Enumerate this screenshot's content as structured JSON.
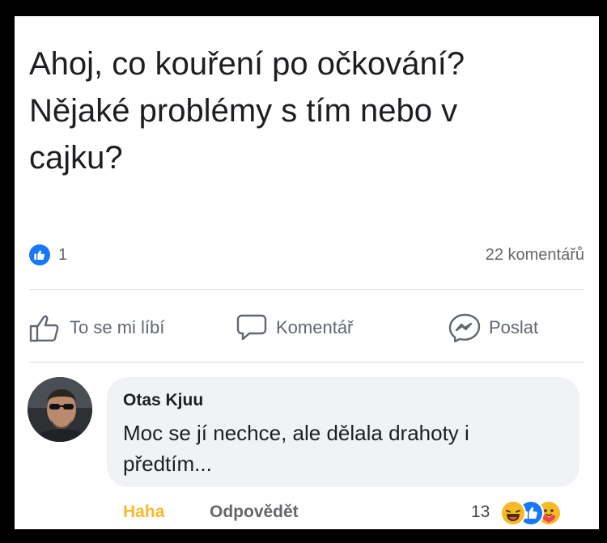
{
  "post": {
    "text_lines": [
      "Ahoj, co kouření po očkování?",
      "Nějaké problémy s tím nebo v",
      "cajku?"
    ]
  },
  "stats": {
    "like_count": "1",
    "comments": "22 komentářů",
    "colors": {
      "like_badge": "#1877f2",
      "text": "#65676b"
    }
  },
  "actions": {
    "like": {
      "label": "To se mi líbí",
      "icon": "thumbs-up-outline-icon"
    },
    "comment": {
      "label": "Komentář",
      "icon": "speech-bubble-icon"
    },
    "share": {
      "label": "Poslat",
      "icon": "messenger-icon"
    }
  },
  "comment": {
    "author": "Otas Kjuu",
    "text_lines": [
      "Moc se jí nechce, ale dělala drahoty i",
      "předtím..."
    ],
    "reaction_label": "Haha",
    "reply_label": "Odpovědět",
    "reaction_count": "13",
    "reaction_icons": [
      "haha-icon",
      "like-icon",
      "care-icon"
    ],
    "colors": {
      "haha": "#f7b928",
      "bubble": "#f0f2f5"
    }
  }
}
